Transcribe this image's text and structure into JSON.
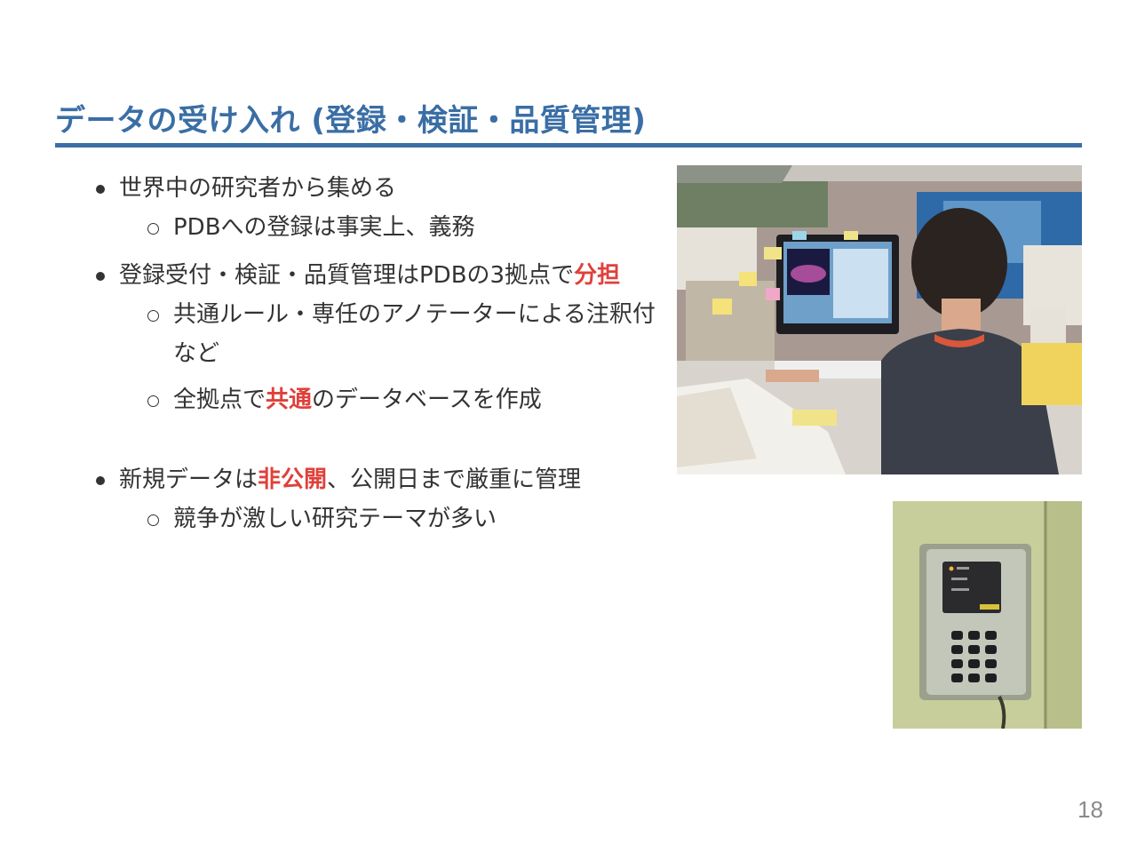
{
  "slide": {
    "title": "データの受け入れ (登録・検証・品質管理)",
    "page_number": "18",
    "accent_color": "#3a6ea5",
    "highlight_color": "#e0403a"
  },
  "bullets": [
    {
      "text": "世界中の研究者から集める",
      "sub": [
        {
          "text": "PDBへの登録は事実上、義務"
        }
      ]
    },
    {
      "text_before": "登録受付・検証・品質管理はPDBの3拠点で",
      "highlight": "分担",
      "sub": [
        {
          "text": "共通ルール・専任のアノテーターによる注釈付など"
        },
        {
          "text_before": "全拠点で",
          "highlight": "共通",
          "text_after": "のデータベースを作成"
        }
      ]
    },
    {
      "text_before": "新規データは",
      "highlight": "非公開",
      "text_after": "、公開日まで厳重に管理",
      "sub": [
        {
          "text": "競争が激しい研究テーマが多い"
        }
      ]
    }
  ],
  "images": {
    "office_photo": "photo-annotator-at-workstation",
    "security_photo": "photo-door-access-keypad"
  }
}
